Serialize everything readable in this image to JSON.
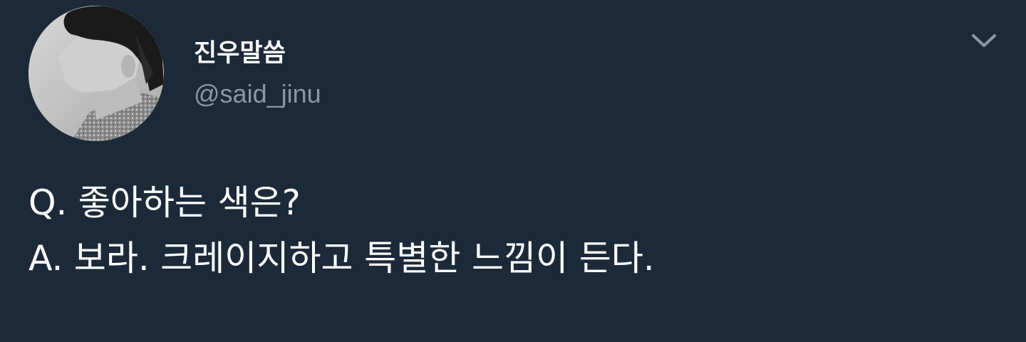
{
  "tweet": {
    "display_name": "진우말씀",
    "handle": "@said_jinu",
    "lines": [
      "Q. 좋아하는 색은?",
      "A. 보라. 크레이지하고 특별한 느낌이 든다."
    ]
  },
  "icons": {
    "menu": "chevron-down-icon",
    "avatar": "profile-photo"
  },
  "colors": {
    "background": "#1c2938",
    "text": "#ffffff",
    "secondary_text": "#8899a6"
  }
}
